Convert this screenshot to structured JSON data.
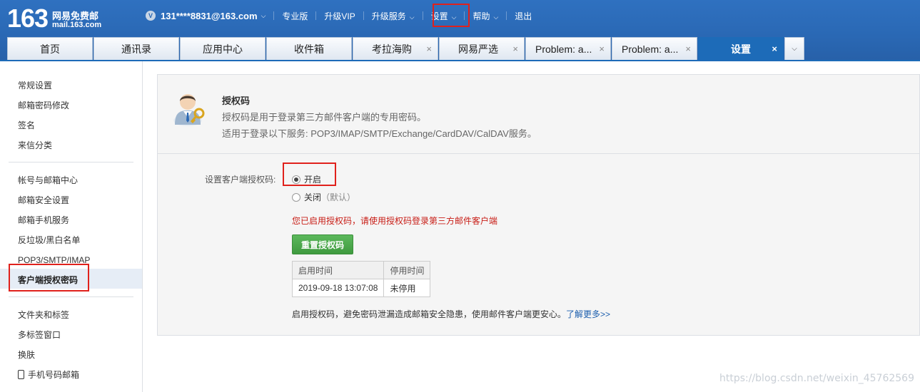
{
  "logo": {
    "number": "163",
    "name_cn": "网易免费邮",
    "domain": "mail.163.com"
  },
  "header": {
    "vip_badge": "V",
    "account": "131****8831@163.com",
    "links": [
      "专业版",
      "升级VIP",
      "升级服务",
      "设置",
      "帮助",
      "退出"
    ]
  },
  "tabs": [
    {
      "label": "首页"
    },
    {
      "label": "通讯录"
    },
    {
      "label": "应用中心"
    },
    {
      "label": "收件箱"
    },
    {
      "label": "考拉海购"
    },
    {
      "label": "网易严选"
    },
    {
      "label": "Problem: a..."
    },
    {
      "label": "Problem: a..."
    },
    {
      "label": "设置"
    }
  ],
  "close_glyph": "×",
  "sidebar": {
    "group1": [
      "常规设置",
      "邮箱密码修改",
      "签名",
      "来信分类"
    ],
    "group2": [
      "帐号与邮箱中心",
      "邮箱安全设置",
      "邮箱手机服务",
      "反垃圾/黑白名单",
      "POP3/SMTP/IMAP",
      "客户端授权密码"
    ],
    "group3": [
      "文件夹和标签",
      "多标签窗口",
      "换肤",
      "手机号码邮箱"
    ]
  },
  "panel": {
    "title": "授权码",
    "desc1": "授权码是用于登录第三方邮件客户端的专用密码。",
    "desc2": "适用于登录以下服务: POP3/IMAP/SMTP/Exchange/CardDAV/CalDAV服务。",
    "setting_label": "设置客户端授权码:",
    "option_on": "开启",
    "option_off": "关闭",
    "option_off_note": "（默认）",
    "warning": "您已启用授权码，请使用授权码登录第三方邮件客户端",
    "reset_button": "重置授权码",
    "table_headers": [
      "启用时间",
      "停用时间"
    ],
    "table_row": [
      "2019-09-18 13:07:08",
      "未停用"
    ],
    "tip": "启用授权码，避免密码泄漏造成邮箱安全隐患，使用邮件客户端更安心。",
    "tip_link": "了解更多>>"
  },
  "watermark": "https://blog.csdn.net/weixin_45762569",
  "colors": {
    "header_blue": "#2a68b4",
    "active_tab": "#1d6bb8",
    "highlight_red": "#e0211c",
    "button_green": "#4cae4c",
    "warning_red": "#c81d16"
  }
}
